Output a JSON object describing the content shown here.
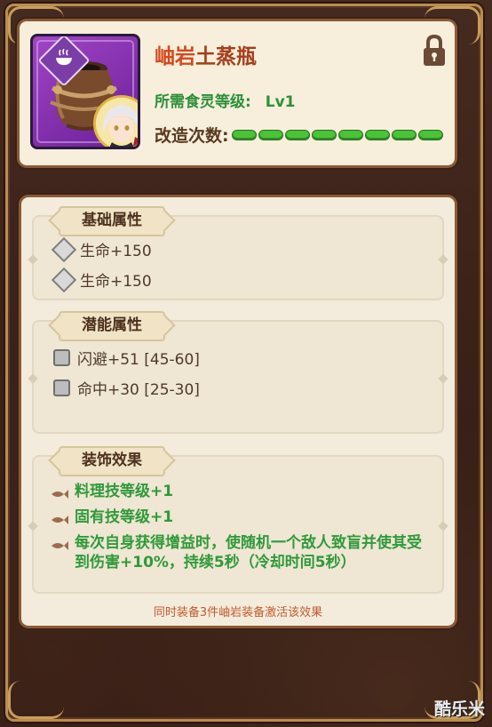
{
  "item": {
    "name_part1": "岫岩",
    "name_part2": "土蒸瓶",
    "requirement_label": "所需食灵等级:",
    "requirement_value": "Lv1",
    "refine_label": "改造次数:",
    "refine_pips": 8,
    "icon": "clay-pot-icon",
    "locked": true
  },
  "sections": {
    "base": {
      "title": "基础属性",
      "rows": [
        "生命+150",
        "生命+150"
      ]
    },
    "potential": {
      "title": "潜能属性",
      "rows": [
        "闪避+51 [45-60]",
        "命中+30 [25-30]"
      ]
    },
    "decoration": {
      "title": "装饰效果",
      "rows": [
        "料理技等级+1",
        "固有技等级+1",
        "每次自身获得增益时，使随机一个敌人致盲并使其受到伤害+10%，持续5秒（冷却时间5秒）"
      ],
      "set_note": "同时装备3件岫岩装备激活该效果"
    }
  },
  "watermark": "酷乐米",
  "colors": {
    "background": "#3b2219",
    "frame_gold": "#b88d4e",
    "rarity_purple": "#8a35b8",
    "name_red": "#d3491d",
    "green_text": "#2f9a3b",
    "pip_green": "#4bc338",
    "note_orange": "#c25a2b"
  }
}
